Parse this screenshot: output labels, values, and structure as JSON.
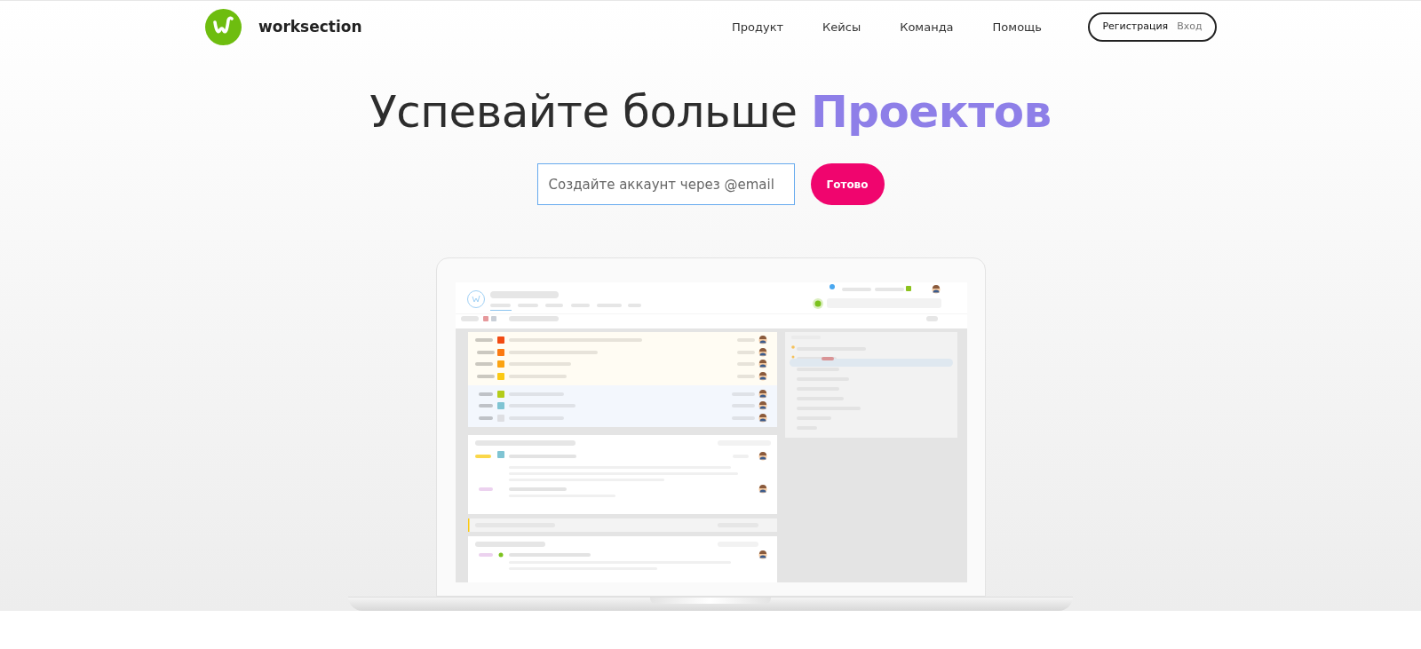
{
  "header": {
    "logo_text": "worksection",
    "nav": [
      "Продукт",
      "Кейсы",
      "Команда",
      "Помощь"
    ],
    "register": "Регистрация",
    "login": "Вход"
  },
  "hero": {
    "title": "Успевайте больше",
    "title_accent": "Проектов",
    "email": {
      "placeholder": "Создайте аккаунт через @email"
    },
    "submit": "Готово"
  }
}
